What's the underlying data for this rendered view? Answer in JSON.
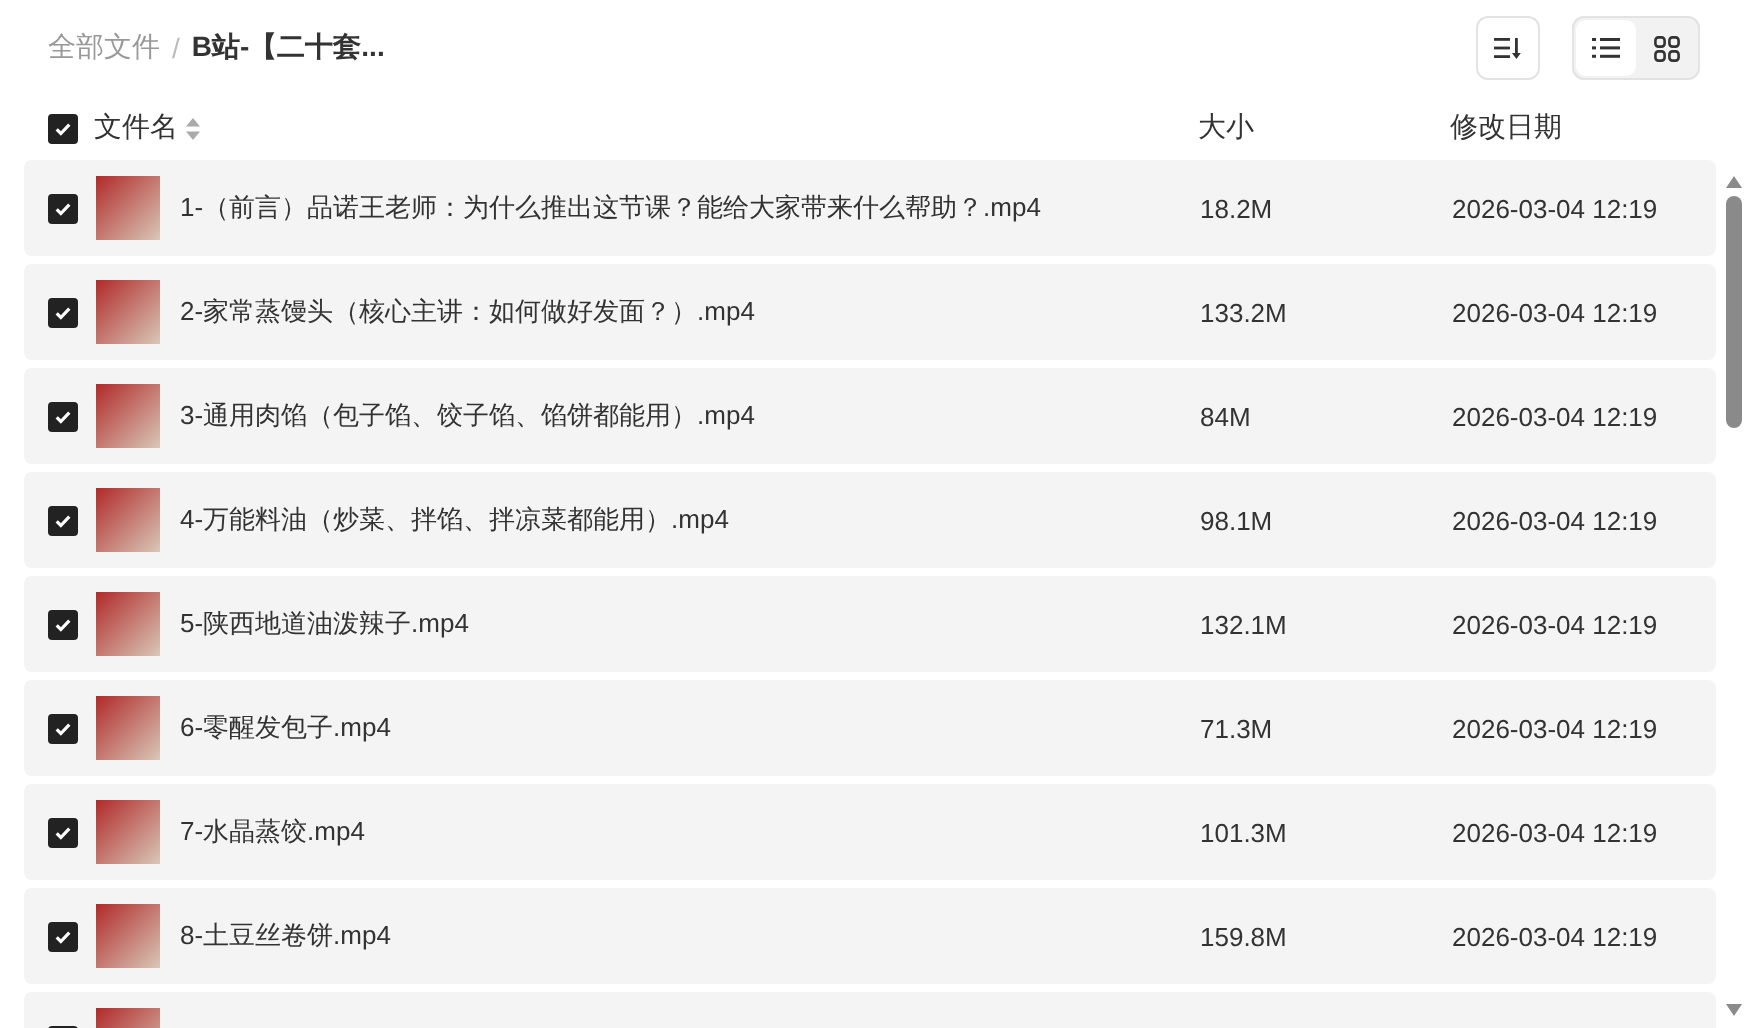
{
  "breadcrumb": {
    "root": "全部文件",
    "separator": "/",
    "current": "B站-【二十套..."
  },
  "view_toggle": [
    {
      "kind": "list",
      "selected": true
    },
    {
      "kind": "grid",
      "selected": false
    }
  ],
  "table": {
    "all_checked": true,
    "columns": [
      "文件名",
      "大小",
      "修改日期"
    ],
    "rows": [
      {
        "checked": true,
        "name": "1-（前言）品诺王老师：为什么推出这节课？能给大家带来什么帮助？.mp4",
        "size": "18.2M",
        "date": "2026-03-04 12:19"
      },
      {
        "checked": true,
        "name": "2-家常蒸馒头（核心主讲：如何做好发面？）.mp4",
        "size": "133.2M",
        "date": "2026-03-04 12:19"
      },
      {
        "checked": true,
        "name": "3-通用肉馅（包子馅、饺子馅、馅饼都能用）.mp4",
        "size": "84M",
        "date": "2026-03-04 12:19"
      },
      {
        "checked": true,
        "name": "4-万能料油（炒菜、拌馅、拌凉菜都能用）.mp4",
        "size": "98.1M",
        "date": "2026-03-04 12:19"
      },
      {
        "checked": true,
        "name": "5-陕西地道油泼辣子.mp4",
        "size": "132.1M",
        "date": "2026-03-04 12:19"
      },
      {
        "checked": true,
        "name": "6-零醒发包子.mp4",
        "size": "71.3M",
        "date": "2026-03-04 12:19"
      },
      {
        "checked": true,
        "name": "7-水晶蒸饺.mp4",
        "size": "101.3M",
        "date": "2026-03-04 12:19"
      },
      {
        "checked": true,
        "name": "8-土豆丝卷饼.mp4",
        "size": "159.8M",
        "date": "2026-03-04 12:19"
      },
      {
        "checked": true
      }
    ]
  }
}
